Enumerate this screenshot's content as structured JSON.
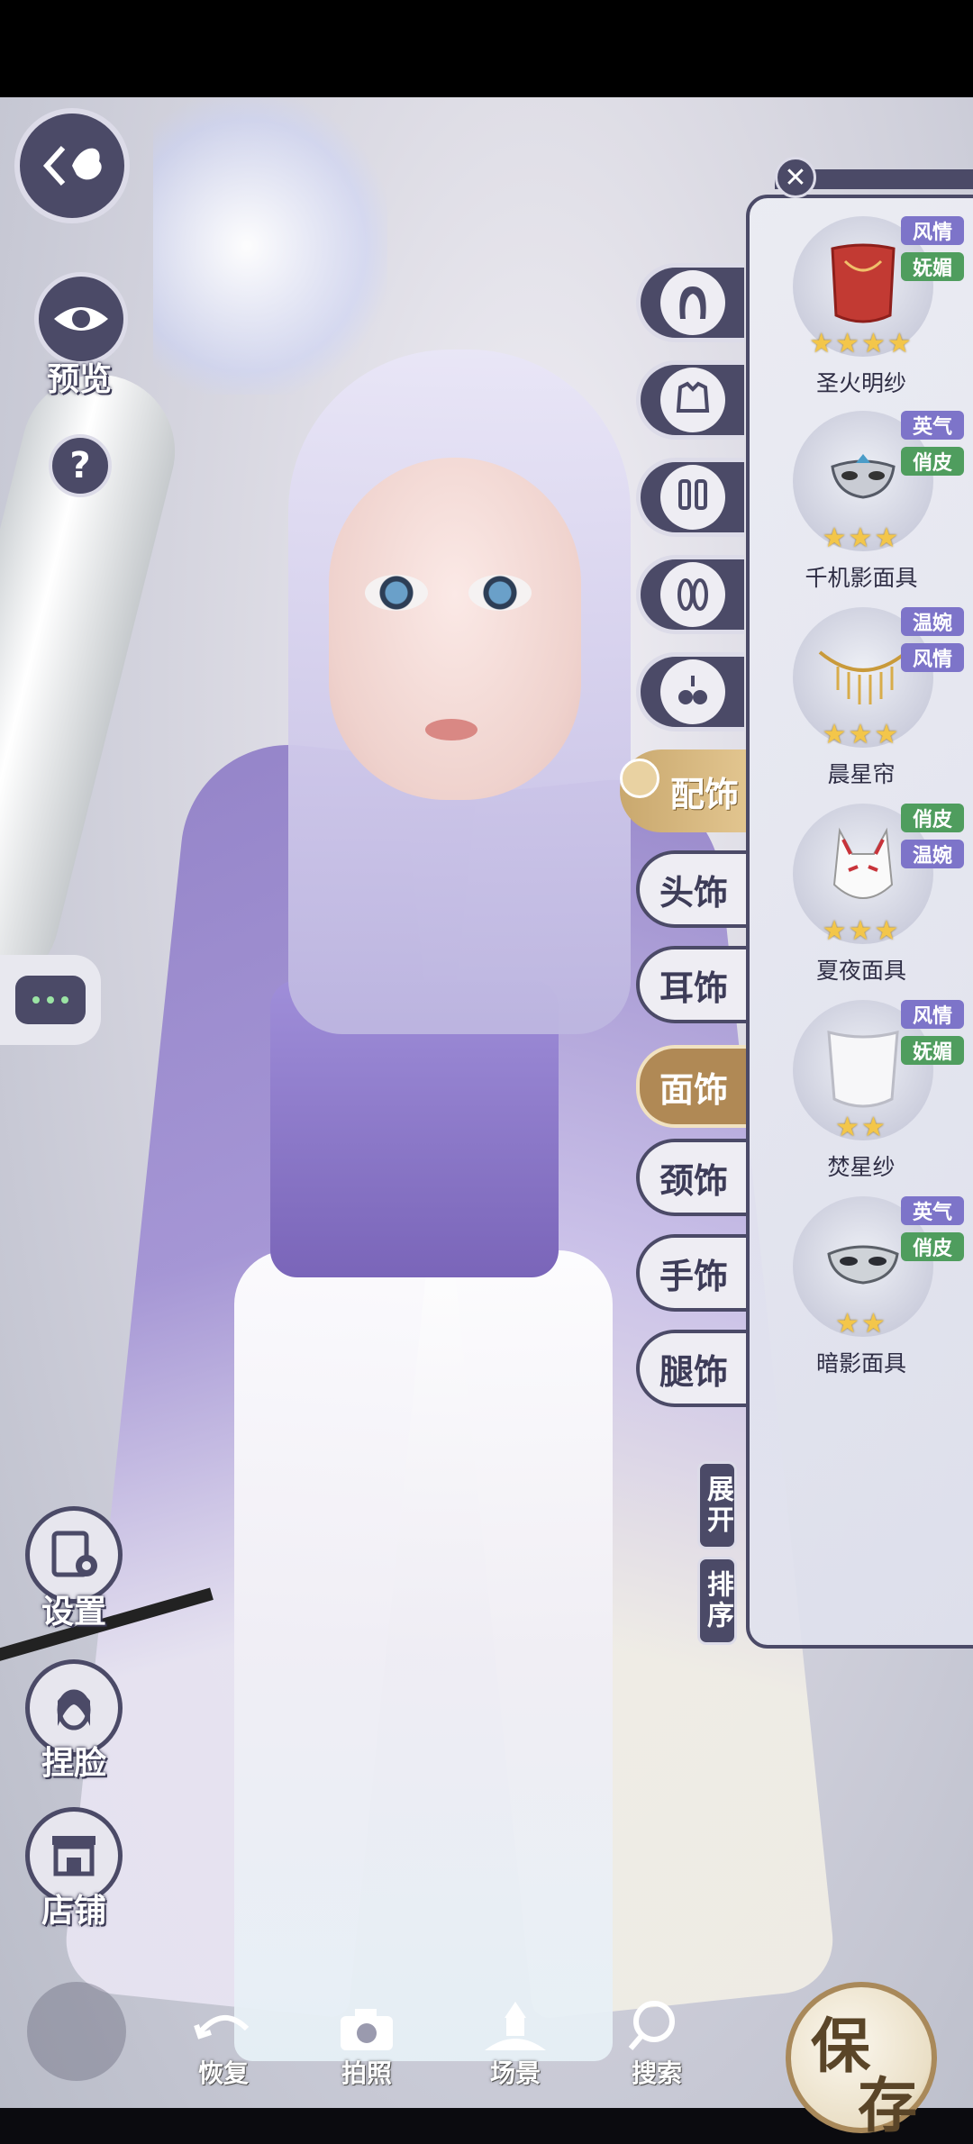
{
  "left_controls": {
    "preview_label": "预览",
    "help_label": "?",
    "settings_label": "设置",
    "face_label": "捏脸",
    "shop_label": "店铺"
  },
  "accessory_category": {
    "label": "配饰",
    "sub_tabs": [
      "头饰",
      "耳饰",
      "面饰",
      "颈饰",
      "手饰",
      "腿饰"
    ],
    "active_sub_tab": "面饰"
  },
  "panel_buttons": {
    "expand_label": "展开",
    "sort_label": "排序",
    "close_label": "✕"
  },
  "items": [
    {
      "name": "圣火明纱",
      "tags": [
        "风情",
        "妩媚"
      ],
      "tag_colors": [
        "purple",
        "green"
      ],
      "stars": 4
    },
    {
      "name": "千机影面具",
      "tags": [
        "英气",
        "俏皮"
      ],
      "tag_colors": [
        "purple",
        "green"
      ],
      "stars": 3
    },
    {
      "name": "晨星帘",
      "tags": [
        "温婉",
        "风情"
      ],
      "tag_colors": [
        "purple",
        "purple"
      ],
      "stars": 3
    },
    {
      "name": "夏夜面具",
      "tags": [
        "俏皮",
        "温婉"
      ],
      "tag_colors": [
        "green",
        "purple"
      ],
      "stars": 3
    },
    {
      "name": "焚星纱",
      "tags": [
        "风情",
        "妩媚"
      ],
      "tag_colors": [
        "purple",
        "green"
      ],
      "stars": 2
    },
    {
      "name": "暗影面具",
      "tags": [
        "英气",
        "俏皮"
      ],
      "tag_colors": [
        "purple",
        "green"
      ],
      "stars": 2
    }
  ],
  "bottom_bar": {
    "restore_label": "恢复",
    "photo_label": "拍照",
    "scene_label": "场景",
    "search_label": "搜索",
    "save_char1": "保",
    "save_char2": "存"
  },
  "colors": {
    "ui_dark": "#4b4a67",
    "accent_gold": "#b08955",
    "tag_purple": "#7d74c9",
    "tag_green": "#4f9d5e",
    "star": "#f3c64a"
  }
}
